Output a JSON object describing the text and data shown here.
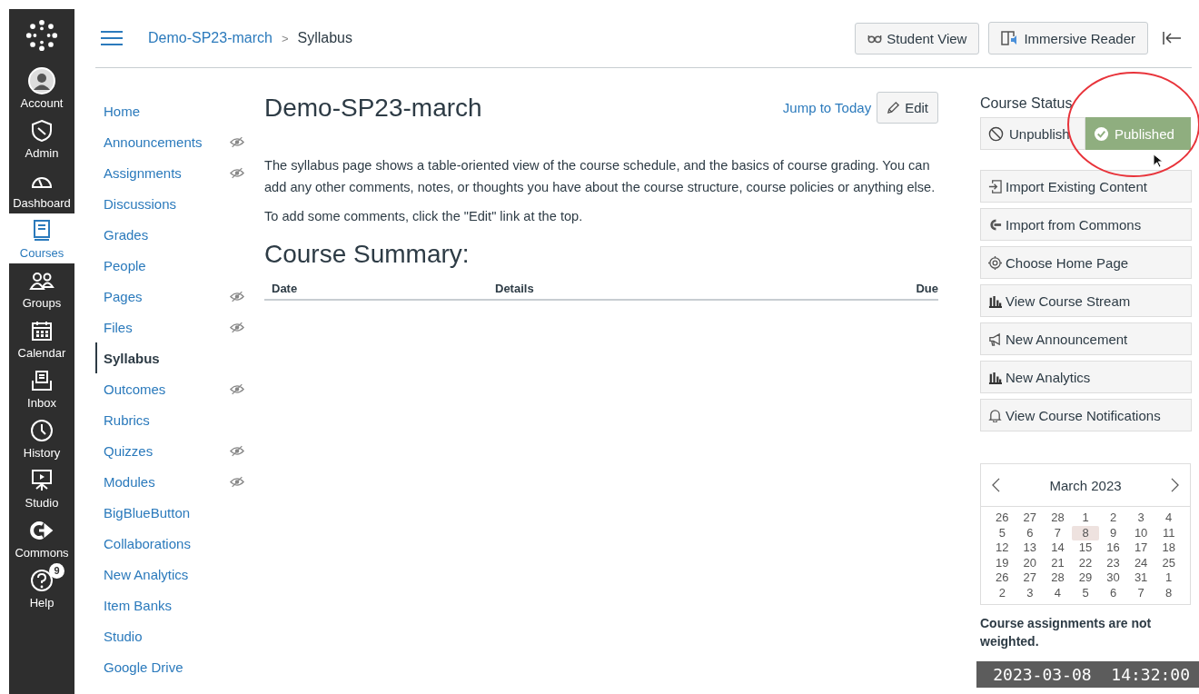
{
  "global_nav": [
    {
      "label": "Account",
      "kind": "avatar",
      "selected": false
    },
    {
      "label": "Admin",
      "kind": "shield",
      "selected": false
    },
    {
      "label": "Dashboard",
      "kind": "gauge",
      "selected": false
    },
    {
      "label": "Courses",
      "kind": "book",
      "selected": true
    },
    {
      "label": "Groups",
      "kind": "people",
      "selected": false
    },
    {
      "label": "Calendar",
      "kind": "calendar",
      "selected": false
    },
    {
      "label": "Inbox",
      "kind": "inbox",
      "selected": false
    },
    {
      "label": "History",
      "kind": "clock",
      "selected": false
    },
    {
      "label": "Studio",
      "kind": "screen",
      "selected": false
    },
    {
      "label": "Commons",
      "kind": "share",
      "selected": false
    },
    {
      "label": "Help",
      "kind": "help",
      "selected": false,
      "badge": "9"
    }
  ],
  "breadcrumb": [
    "Demo-SP23-march",
    "Syllabus"
  ],
  "breadcrumb_separator": ">",
  "header_buttons": [
    {
      "label": "Student View",
      "kind": "glasses"
    },
    {
      "label": "Immersive Reader",
      "kind": "reader"
    }
  ],
  "course_nav": [
    {
      "label": "Home",
      "hidden": false,
      "selected": false
    },
    {
      "label": "Announcements",
      "hidden": true,
      "selected": false
    },
    {
      "label": "Assignments",
      "hidden": true,
      "selected": false
    },
    {
      "label": "Discussions",
      "hidden": false,
      "selected": false
    },
    {
      "label": "Grades",
      "hidden": false,
      "selected": false
    },
    {
      "label": "People",
      "hidden": false,
      "selected": false
    },
    {
      "label": "Pages",
      "hidden": true,
      "selected": false
    },
    {
      "label": "Files",
      "hidden": true,
      "selected": false
    },
    {
      "label": "Syllabus",
      "hidden": false,
      "selected": true
    },
    {
      "label": "Outcomes",
      "hidden": true,
      "selected": false
    },
    {
      "label": "Rubrics",
      "hidden": false,
      "selected": false
    },
    {
      "label": "Quizzes",
      "hidden": true,
      "selected": false
    },
    {
      "label": "Modules",
      "hidden": true,
      "selected": false
    },
    {
      "label": "BigBlueButton",
      "hidden": false,
      "selected": false
    },
    {
      "label": "Collaborations",
      "hidden": false,
      "selected": false
    },
    {
      "label": "New Analytics",
      "hidden": false,
      "selected": false
    },
    {
      "label": "Item Banks",
      "hidden": false,
      "selected": false
    },
    {
      "label": "Studio",
      "hidden": false,
      "selected": false
    },
    {
      "label": "Google Drive",
      "hidden": false,
      "selected": false
    }
  ],
  "page": {
    "title": "Demo-SP23-march",
    "jump_link": "Jump to Today",
    "edit_button": "Edit",
    "paragraphs": [
      "The syllabus page shows a table-oriented view of the course schedule, and the basics of course grading. You can add any other comments, notes, or thoughts you have about the course structure, course policies or anything else.",
      "To add some comments, click the \"Edit\" link at the top."
    ],
    "summary_title": "Course Summary:",
    "table": {
      "columns": [
        "Date",
        "Details",
        "Due"
      ]
    }
  },
  "course_status": {
    "title": "Course Status",
    "options": [
      {
        "label": "Unpublish",
        "selected": false
      },
      {
        "label": "Published",
        "selected": true
      }
    ]
  },
  "actions": [
    {
      "label": "Import Existing Content",
      "kind": "import"
    },
    {
      "label": "Import from Commons",
      "kind": "commons"
    },
    {
      "label": "Choose Home Page",
      "kind": "target"
    },
    {
      "label": "View Course Stream",
      "kind": "bars"
    },
    {
      "label": "New Announcement",
      "kind": "megaphone"
    },
    {
      "label": "New Analytics",
      "kind": "bars"
    },
    {
      "label": "View Course Notifications",
      "kind": "bell"
    }
  ],
  "calendar": {
    "month": "March 2023",
    "weeks": [
      [
        {
          "d": "26",
          "selected": false
        },
        {
          "d": "27",
          "selected": false
        },
        {
          "d": "28",
          "selected": false
        },
        {
          "d": "1",
          "selected": false
        },
        {
          "d": "2",
          "selected": false
        },
        {
          "d": "3",
          "selected": false
        },
        {
          "d": "4",
          "selected": false
        }
      ],
      [
        {
          "d": "5",
          "selected": false
        },
        {
          "d": "6",
          "selected": false
        },
        {
          "d": "7",
          "selected": false
        },
        {
          "d": "8",
          "selected": true
        },
        {
          "d": "9",
          "selected": false
        },
        {
          "d": "10",
          "selected": false
        },
        {
          "d": "11",
          "selected": false
        }
      ],
      [
        {
          "d": "12",
          "selected": false
        },
        {
          "d": "13",
          "selected": false
        },
        {
          "d": "14",
          "selected": false
        },
        {
          "d": "15",
          "selected": false
        },
        {
          "d": "16",
          "selected": false
        },
        {
          "d": "17",
          "selected": false
        },
        {
          "d": "18",
          "selected": false
        }
      ],
      [
        {
          "d": "19",
          "selected": false
        },
        {
          "d": "20",
          "selected": false
        },
        {
          "d": "21",
          "selected": false
        },
        {
          "d": "22",
          "selected": false
        },
        {
          "d": "23",
          "selected": false
        },
        {
          "d": "24",
          "selected": false
        },
        {
          "d": "25",
          "selected": false
        }
      ],
      [
        {
          "d": "26",
          "selected": false
        },
        {
          "d": "27",
          "selected": false
        },
        {
          "d": "28",
          "selected": false
        },
        {
          "d": "29",
          "selected": false
        },
        {
          "d": "30",
          "selected": false
        },
        {
          "d": "31",
          "selected": false
        },
        {
          "d": "1",
          "selected": false
        }
      ],
      [
        {
          "d": "2",
          "selected": false
        },
        {
          "d": "3",
          "selected": false
        },
        {
          "d": "4",
          "selected": false
        },
        {
          "d": "5",
          "selected": false
        },
        {
          "d": "6",
          "selected": false
        },
        {
          "d": "7",
          "selected": false
        },
        {
          "d": "8",
          "selected": false
        }
      ]
    ]
  },
  "grading_note": "Course assignments are not weighted.",
  "recording_timestamp": "2023-03-08  14:32:00"
}
